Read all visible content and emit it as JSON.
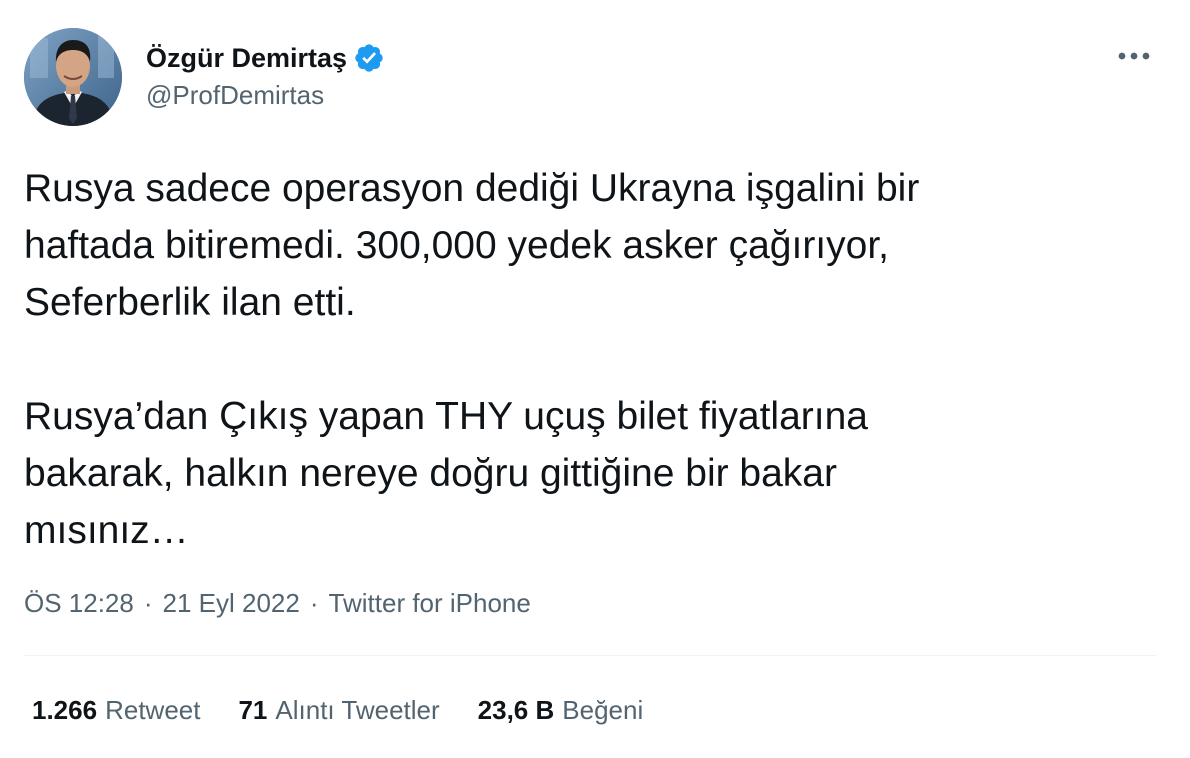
{
  "author": {
    "display_name": "Özgür Demirtaş",
    "handle": "@ProfDemirtas",
    "verified": true,
    "verified_color": "#1d9bf0",
    "avatar_icon": "profile-photo"
  },
  "menu": {
    "more_icon": "ellipsis-icon"
  },
  "tweet": {
    "text": "Rusya sadece operasyon dediği Ukrayna işgalini bir\nhaftada bitiremedi. 300,000 yedek asker çağırıyor,\nSeferberlik ilan etti.\n\nRusya’dan Çıkış yapan THY uçuş bilet fiyatlarına\nbakarak, halkın nereye doğru gittiğine bir bakar\nmısınız…"
  },
  "meta": {
    "time": "ÖS 12:28",
    "separator": "·",
    "date": "21 Eyl 2022",
    "source": "Twitter for iPhone"
  },
  "stats": {
    "retweets": {
      "count": "1.266",
      "label": "Retweet"
    },
    "quotes": {
      "count": "71",
      "label": "Alıntı Tweetler"
    },
    "likes": {
      "count": "23,6 B",
      "label": "Beğeni"
    }
  },
  "colors": {
    "text_primary": "#0f1419",
    "text_secondary": "#536471",
    "divider": "#eff3f4",
    "accent": "#1d9bf0"
  }
}
